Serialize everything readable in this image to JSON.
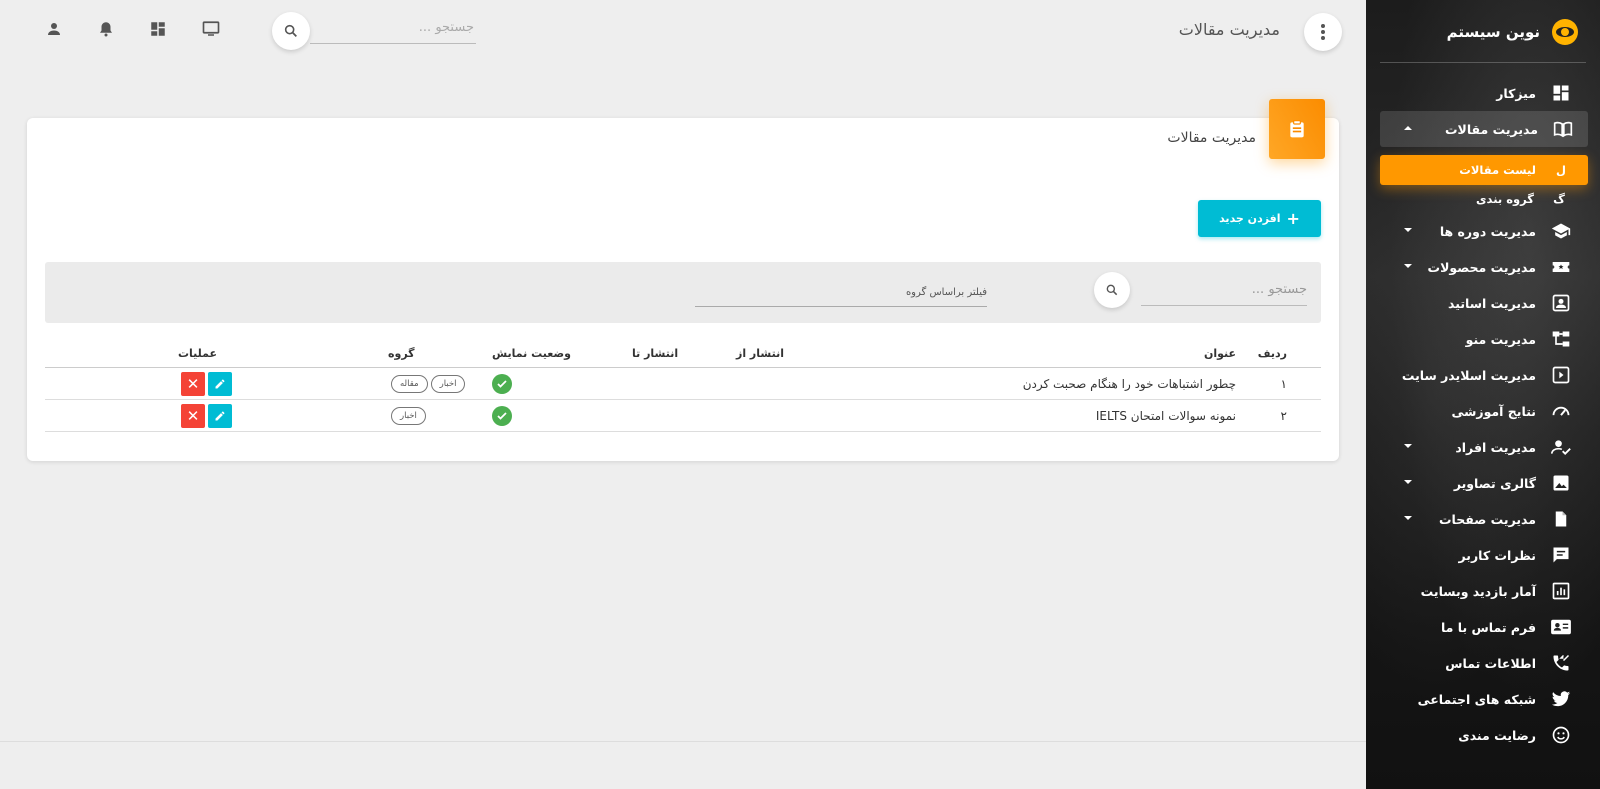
{
  "brand": {
    "name": "نوین سیستم"
  },
  "sidebar": {
    "items": [
      {
        "label": "میزکار",
        "icon": "dashboard-icon",
        "caret": ""
      },
      {
        "label": "مدیریت مقالات",
        "icon": "book-icon",
        "caret": "up",
        "expanded": true
      },
      {
        "label": "مدیریت دوره ها",
        "icon": "school-icon",
        "caret": "down"
      },
      {
        "label": "مدیریت محصولات",
        "icon": "ticket-icon",
        "caret": "down"
      },
      {
        "label": "مدیریت اساتید",
        "icon": "contact-icon",
        "caret": ""
      },
      {
        "label": "مدیریت منو",
        "icon": "tree-icon",
        "caret": ""
      },
      {
        "label": "مدیریت اسلایدر سایت",
        "icon": "slider-icon",
        "caret": ""
      },
      {
        "label": "نتایج آموزشی",
        "icon": "speedometer-icon",
        "caret": ""
      },
      {
        "label": "مدیریت افراد",
        "icon": "user-check-icon",
        "caret": "down"
      },
      {
        "label": "گالری تصاویر",
        "icon": "image-icon",
        "caret": "down"
      },
      {
        "label": "مدیریت صفحات",
        "icon": "file-icon",
        "caret": "down"
      },
      {
        "label": "نظرات کاربر",
        "icon": "comment-icon",
        "caret": ""
      },
      {
        "label": "آمار بازدید وبسایت",
        "icon": "chart-icon",
        "caret": ""
      },
      {
        "label": "فرم تماس با ما",
        "icon": "contact-card-icon",
        "caret": ""
      },
      {
        "label": "اطلاعات تماس",
        "icon": "phone-icon",
        "caret": ""
      },
      {
        "label": "شبکه های اجتماعی",
        "icon": "twitter-icon",
        "caret": ""
      },
      {
        "label": "رضایت مندی",
        "icon": "smiley-icon",
        "caret": ""
      }
    ],
    "subitems": [
      {
        "letter": "ل",
        "label": "لیست مقالات",
        "active": true
      },
      {
        "letter": "گ",
        "label": "گروه بندی",
        "active": false
      }
    ]
  },
  "topbar": {
    "title": "مدیریت مقالات",
    "search_placeholder": "جستجو ..."
  },
  "card": {
    "title": "مدیریت مقالات",
    "add_label": "افزدن جدید",
    "search_placeholder": "جستجو ...",
    "filter_label": "فیلتر براساس گروه"
  },
  "table": {
    "headers": {
      "idx": "ردیف",
      "title": "عنوان",
      "from": "انتشار از",
      "to": "انتشار تا",
      "status": "وضعیت نمایش",
      "group": "گروه",
      "ops": "عملیات"
    },
    "rows": [
      {
        "idx": "۱",
        "title": "چطور اشتباهات خود را هنگام صحبت کردن",
        "from": "",
        "to": "",
        "status": "visible",
        "tags": [
          "اخبار",
          "مقاله"
        ]
      },
      {
        "idx": "۲",
        "title": "نمونه سوالات امتحان IELTS",
        "from": "",
        "to": "",
        "status": "visible",
        "tags": [
          "اخبار"
        ]
      }
    ],
    "delete_symbol": "✕"
  },
  "colors": {
    "accent": "#ff9800",
    "primary": "#00bcd4",
    "danger": "#f44336",
    "success": "#4caf50"
  }
}
